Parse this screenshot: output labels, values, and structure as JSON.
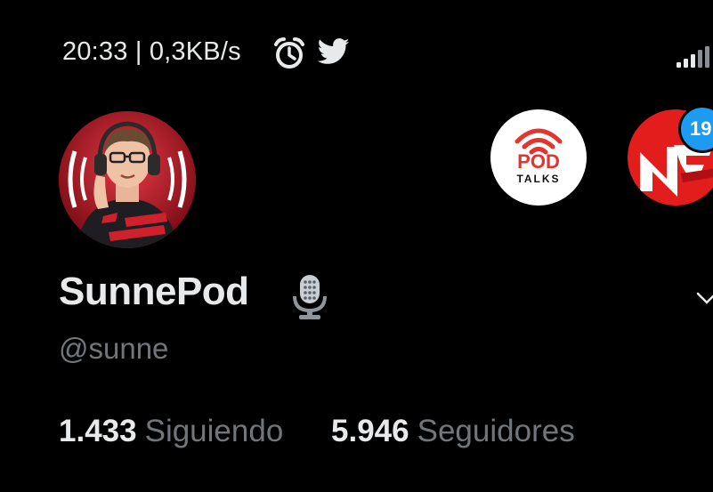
{
  "status_bar": {
    "time_speed": "20:33 | 0,3KB/s",
    "icons": [
      "alarm-icon",
      "twitter-icon",
      "signal-icon"
    ]
  },
  "accounts": {
    "podtalks": {
      "logo_top": "POD",
      "logo_bottom": "TALKS"
    },
    "nf": {
      "badge_count": "19"
    }
  },
  "profile": {
    "name": "SunnePod",
    "name_icon": "microphone-icon",
    "handle": "@sunne",
    "following_count": "1.433",
    "following_label": "Siguiendo",
    "followers_count": "5.946",
    "followers_label": "Seguidores"
  },
  "colors": {
    "background": "#000000",
    "text": "#e7e9ea",
    "muted": "#71767b",
    "badge": "#1d9bf0",
    "podtalks_red": "#e3342f",
    "nf_red": "#e31c1c"
  }
}
